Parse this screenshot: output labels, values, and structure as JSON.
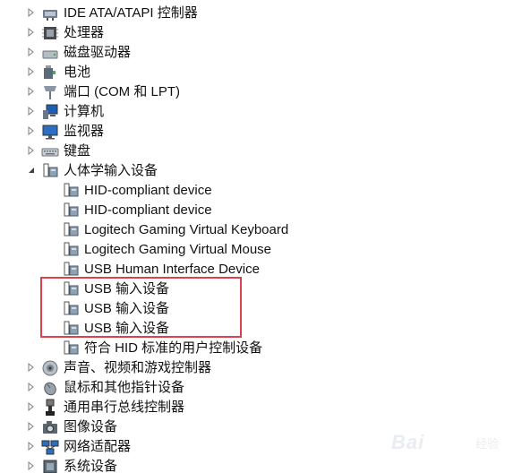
{
  "tree": {
    "categories_top": [
      {
        "label": "IDE ATA/ATAPI 控制器",
        "icon": "ide-controller-icon"
      },
      {
        "label": "处理器",
        "icon": "processor-icon"
      },
      {
        "label": "磁盘驱动器",
        "icon": "disk-drive-icon"
      },
      {
        "label": "电池",
        "icon": "battery-icon"
      },
      {
        "label": "端口 (COM 和 LPT)",
        "icon": "port-icon"
      },
      {
        "label": "计算机",
        "icon": "computer-icon"
      },
      {
        "label": "监视器",
        "icon": "monitor-icon"
      },
      {
        "label": "键盘",
        "icon": "keyboard-icon"
      }
    ],
    "hid_category": {
      "label": "人体学输入设备",
      "icon": "hid-icon",
      "expanded": true
    },
    "hid_children": [
      {
        "label": "HID-compliant device"
      },
      {
        "label": "HID-compliant device"
      },
      {
        "label": "Logitech Gaming Virtual Keyboard"
      },
      {
        "label": "Logitech Gaming Virtual Mouse"
      },
      {
        "label": "USB Human Interface Device"
      },
      {
        "label": "USB 输入设备"
      },
      {
        "label": "USB 输入设备"
      },
      {
        "label": "USB 输入设备"
      },
      {
        "label": "符合 HID 标准的用户控制设备"
      }
    ],
    "categories_bottom": [
      {
        "label": "声音、视频和游戏控制器",
        "icon": "sound-icon"
      },
      {
        "label": "鼠标和其他指针设备",
        "icon": "mouse-icon"
      },
      {
        "label": "通用串行总线控制器",
        "icon": "usb-controller-icon"
      },
      {
        "label": "图像设备",
        "icon": "camera-icon"
      },
      {
        "label": "网络适配器",
        "icon": "network-adapter-icon"
      },
      {
        "label": "系统设备",
        "icon": "system-device-icon"
      }
    ]
  },
  "colors": {
    "highlight": "#d9434b",
    "text": "#111111",
    "expander": "#808080"
  },
  "watermark": {
    "text": "Bai",
    "sub": "经验"
  }
}
